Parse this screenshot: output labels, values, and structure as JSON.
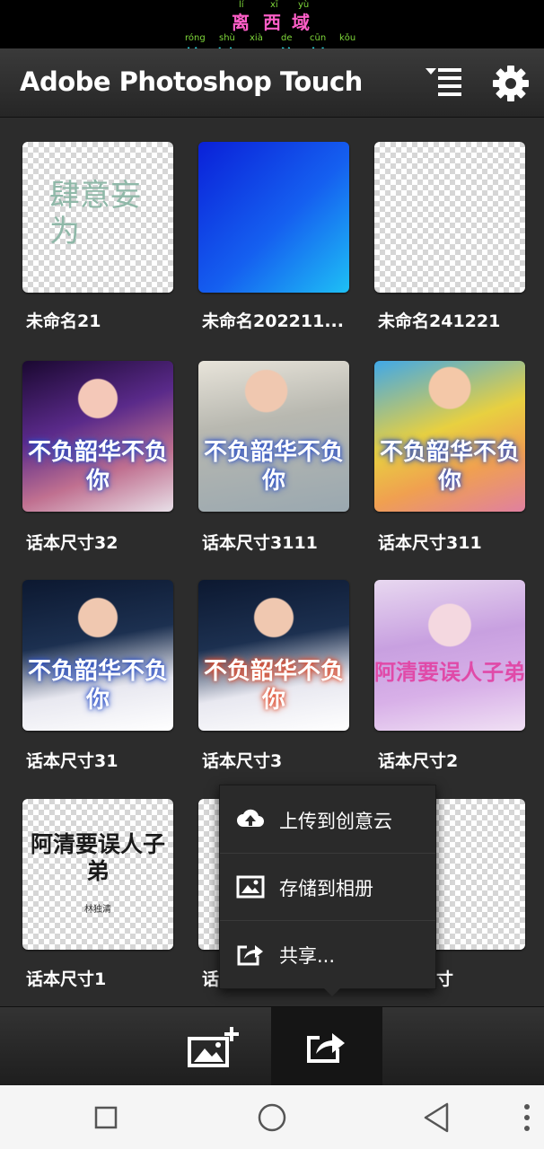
{
  "status": {
    "pinyin": [
      "lí",
      "xī",
      "yù",
      "róng",
      "shù",
      "xià",
      "de",
      "cūn",
      "kǒu"
    ],
    "line1": [
      "离",
      "西",
      "域"
    ],
    "line2": [
      "榕",
      "树",
      "下",
      "的",
      "村",
      "口"
    ]
  },
  "app": {
    "title": "Adobe Photoshop Touch"
  },
  "projects": [
    {
      "label": "未命名21",
      "art_text": "肆意妄为"
    },
    {
      "label": "未命名202211..."
    },
    {
      "label": "未命名241221"
    },
    {
      "label": "话本尺寸32",
      "art_text": "不负韶华不负你"
    },
    {
      "label": "话本尺寸3111",
      "art_text": "不负韶华不负你"
    },
    {
      "label": "话本尺寸311",
      "art_text": "不负韶华不负你"
    },
    {
      "label": "话本尺寸31",
      "art_text": "不负韶华不负你"
    },
    {
      "label": "话本尺寸3",
      "art_text": "不负韶华不负你"
    },
    {
      "label": "话本尺寸2",
      "art_text": "阿清要误人子弟"
    },
    {
      "label": "话本尺寸1",
      "art_text": "阿清要误人子弟",
      "sub_text": "林独清"
    },
    {
      "label": "话"
    },
    {
      "label": "寸"
    }
  ],
  "share_menu": {
    "items": [
      {
        "label": "上传到创意云",
        "icon": "cloud-upload-icon"
      },
      {
        "label": "存储到相册",
        "icon": "image-icon"
      },
      {
        "label": "共享...",
        "icon": "share-icon"
      }
    ]
  },
  "colors": {
    "appbar": "#2e2e2e",
    "background": "#2c2c2c",
    "pinyin": "#7fd83a"
  }
}
